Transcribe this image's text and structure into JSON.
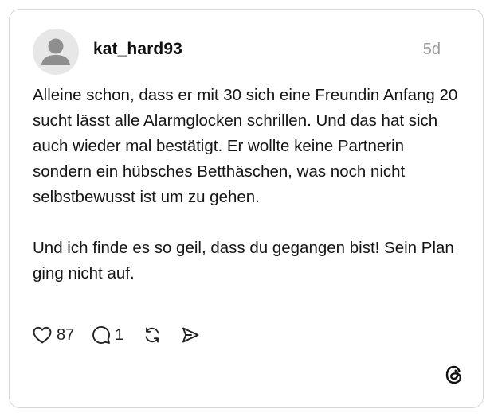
{
  "post": {
    "username": "kat_hard93",
    "timestamp": "5d",
    "paragraphs": [
      "Alleine schon, dass er mit 30 sich eine Freundin Anfang 20 sucht lässt alle Alarmglocken schrillen. Und das hat sich auch wieder mal bestätigt. Er wollte keine Partnerin sondern ein hübsches Betthäschen, was noch nicht selbstbewusst ist um zu gehen.",
      "Und ich finde es so geil, dass du gegangen bist! Sein Plan ging nicht auf."
    ],
    "likes": "87",
    "replies": "1"
  },
  "icons": {
    "avatar": "default-user-avatar",
    "like": "heart-icon",
    "reply": "speech-bubble-icon",
    "repost": "repost-arrows-icon",
    "share": "paper-plane-icon",
    "logo": "threads-logo"
  }
}
